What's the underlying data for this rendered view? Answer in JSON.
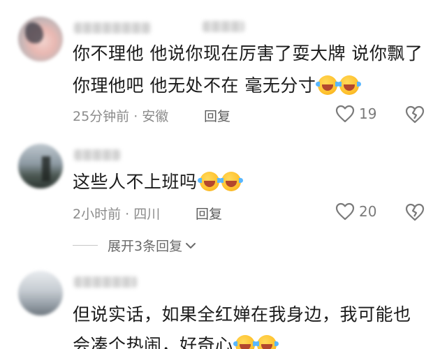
{
  "comments": [
    {
      "lines": [
        "你不理他 他说你现在厉害了耍大牌 说你飘了",
        "你理他吧 他无处不在 毫无分寸"
      ],
      "meta": "25分钟前 · 安徽",
      "reply_label": "回复",
      "likes": "19"
    },
    {
      "lines": [
        "这些人不上班吗"
      ],
      "meta": "2小时前 · 四川",
      "reply_label": "回复",
      "likes": "20"
    },
    {
      "lines": [
        "但说实话，如果全红婵在我身边，我可能也",
        "会凑个热闹，好奇心"
      ],
      "meta": "",
      "reply_label": "",
      "likes": ""
    }
  ],
  "expand_replies": "展开3条回复",
  "icons": {
    "like": "heart-icon",
    "dislike": "broken-heart-icon",
    "expand": "chevron-down-icon",
    "emoji": "laughing-tears-emoji-icon"
  },
  "colors": {
    "text": "#1b1b1b",
    "meta": "#8b8b8b",
    "icon": "#7a7a7a",
    "emoji": "#ffc22e"
  }
}
